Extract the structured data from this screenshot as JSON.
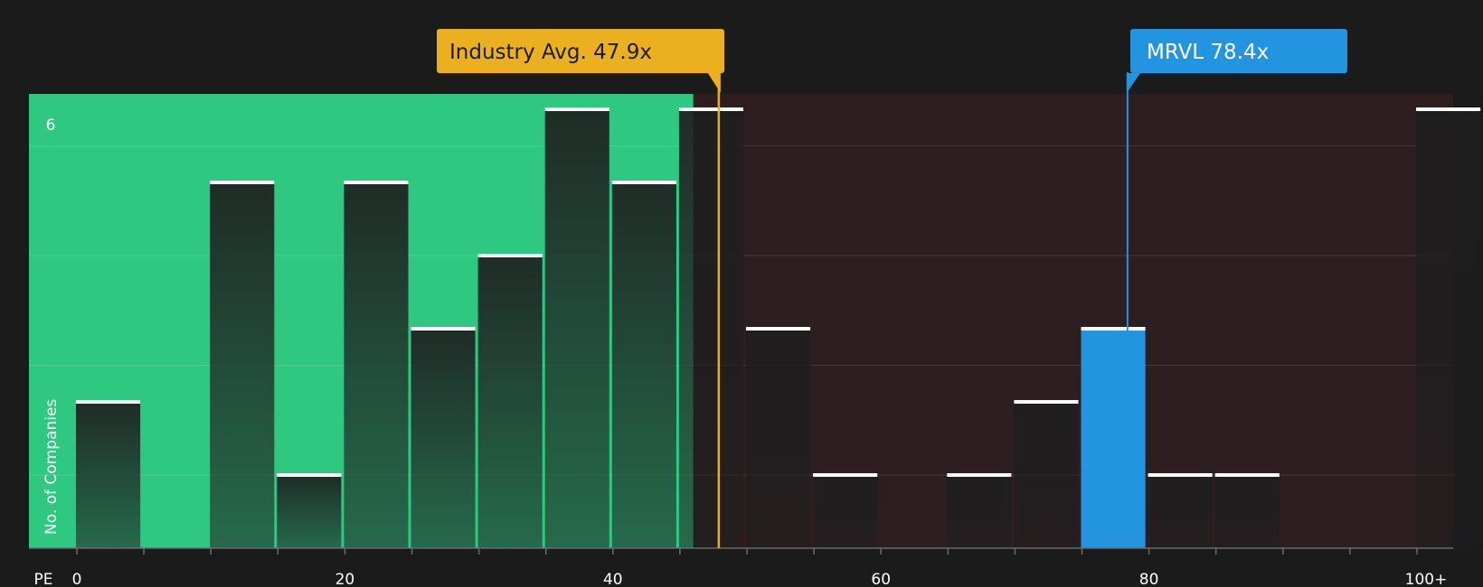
{
  "chart_data": {
    "type": "bar",
    "xlabel": "PE",
    "ylabel": "No. of Companies",
    "y_tick_labels": [
      "6"
    ],
    "ylim": [
      0,
      6
    ],
    "xlim": [
      -3.7,
      103.3
    ],
    "x_ticks": [
      0,
      20,
      40,
      60,
      80,
      100
    ],
    "x_tick_labels": [
      "0",
      "20",
      "40",
      "60",
      "80",
      "100+"
    ],
    "bin_width": 5,
    "bins": [
      {
        "start": 0,
        "value": 2
      },
      {
        "start": 10,
        "value": 5
      },
      {
        "start": 15,
        "value": 1
      },
      {
        "start": 20,
        "value": 5
      },
      {
        "start": 25,
        "value": 3
      },
      {
        "start": 30,
        "value": 4
      },
      {
        "start": 35,
        "value": 6
      },
      {
        "start": 40,
        "value": 5
      },
      {
        "start": 45,
        "value": 6
      },
      {
        "start": 50,
        "value": 3
      },
      {
        "start": 55,
        "value": 1
      },
      {
        "start": 65,
        "value": 1
      },
      {
        "start": 70,
        "value": 2
      },
      {
        "start": 75,
        "value": 3,
        "highlight": true
      },
      {
        "start": 80,
        "value": 1
      },
      {
        "start": 85,
        "value": 1
      },
      {
        "start": 100,
        "value": 6
      }
    ],
    "industry_avg": {
      "label": "Industry Avg. 47.9x",
      "value": 47.9
    },
    "company": {
      "label": "MRVL 78.4x",
      "value": 78.4
    },
    "good_zone_end": 46.0,
    "colors": {
      "background": "#1b1b1c",
      "good_zone": "#2ec880",
      "bad_zone": "#2d1f20",
      "industry": "#eab020",
      "company": "#2394e0",
      "bar_cap": "#ffffff"
    },
    "grid": true
  }
}
